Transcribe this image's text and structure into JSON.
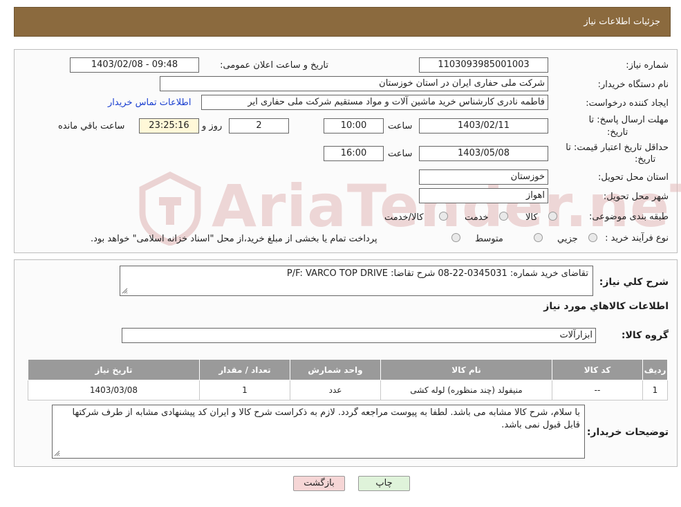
{
  "header": {
    "title": "جزئیات اطلاعات نیاز"
  },
  "form": {
    "need_number_label": "شماره نیاز:",
    "need_number": "1103093985001003",
    "announce_label": "تاریخ و ساعت اعلان عمومی:",
    "announce_value": "1403/02/08 - 09:48",
    "buyer_org_label": "نام دستگاه خریدار:",
    "buyer_org": "شرکت ملی حفاری ایران در استان خوزستان",
    "creator_label": "ایجاد کننده درخواست:",
    "creator": "فاطمه نادری کارشناس خرید ماشین آلات و مواد مستقیم شرکت ملی حفاری ایر",
    "contact_link": "اطلاعات تماس خریدار",
    "reply_deadline_label": "مهلت ارسال پاسخ: تا",
    "date_label": "تاریخ:",
    "reply_date": "1403/02/11",
    "time_label": "ساعت",
    "reply_time": "10:00",
    "days": "2",
    "days_label": "روز و",
    "remaining_time": "23:25:16",
    "remaining_label": "ساعت باقي مانده",
    "validity_label": "حداقل تاریخ اعتبار قیمت: تا",
    "validity_date": "1403/05/08",
    "validity_time": "16:00",
    "province_label": "استان محل تحویل:",
    "province": "خوزستان",
    "city_label": "شهر محل تحویل:",
    "city": "اهواز",
    "category_label": "طبقه بندی موضوعی:",
    "category_options": [
      "کالا",
      "خدمت",
      "کالا/خدمت"
    ],
    "process_label": "نوع فرآیند خرید :",
    "process_options": [
      "جزیي",
      "متوسط"
    ],
    "process_note": "پرداخت تمام یا بخشی از مبلغ خرید،از محل \"اسناد خزانه اسلامی\" خواهد بود."
  },
  "general": {
    "desc_label": "شرح کلي نیاز:",
    "desc": "تقاضای خرید شماره:  0345031-22-08 شرح تقاضا: P/F: VARCO TOP DRIVE",
    "goods_info_title": "اطلاعات کالاهاي مورد نیاز",
    "group_label": "گروه کالا:",
    "group": "ابزارآلات"
  },
  "table": {
    "headers": [
      "ردیف",
      "کد کالا",
      "نام کالا",
      "واحد شمارش",
      "تعداد / مقدار",
      "تاریخ نیاز"
    ],
    "rows": [
      [
        "1",
        "--",
        "منیفولد (چند منظوره) لوله کشی",
        "عدد",
        "1",
        "1403/03/08"
      ]
    ]
  },
  "buyer_notes": {
    "label": "توضیحات خریدار:",
    "text": "با سلام، شرح کالا مشابه می باشد. لطفا به پیوست مراجعه گردد. لازم به ذکراست شرح کالا و ایران کد  پیشنهادی مشابه از طرف شرکتها قابل قبول نمی باشد."
  },
  "buttons": {
    "print": "چاپ",
    "back": "بازگشت"
  },
  "watermark": {
    "text": "AriaTender.neT"
  },
  "colors": {
    "header_bg": "#8b6a3e",
    "link": "#1a3fd0",
    "back_btn_bg": "#f6d6d6",
    "print_btn_bg": "#dff3da",
    "table_header_bg": "#9a9a9a"
  }
}
